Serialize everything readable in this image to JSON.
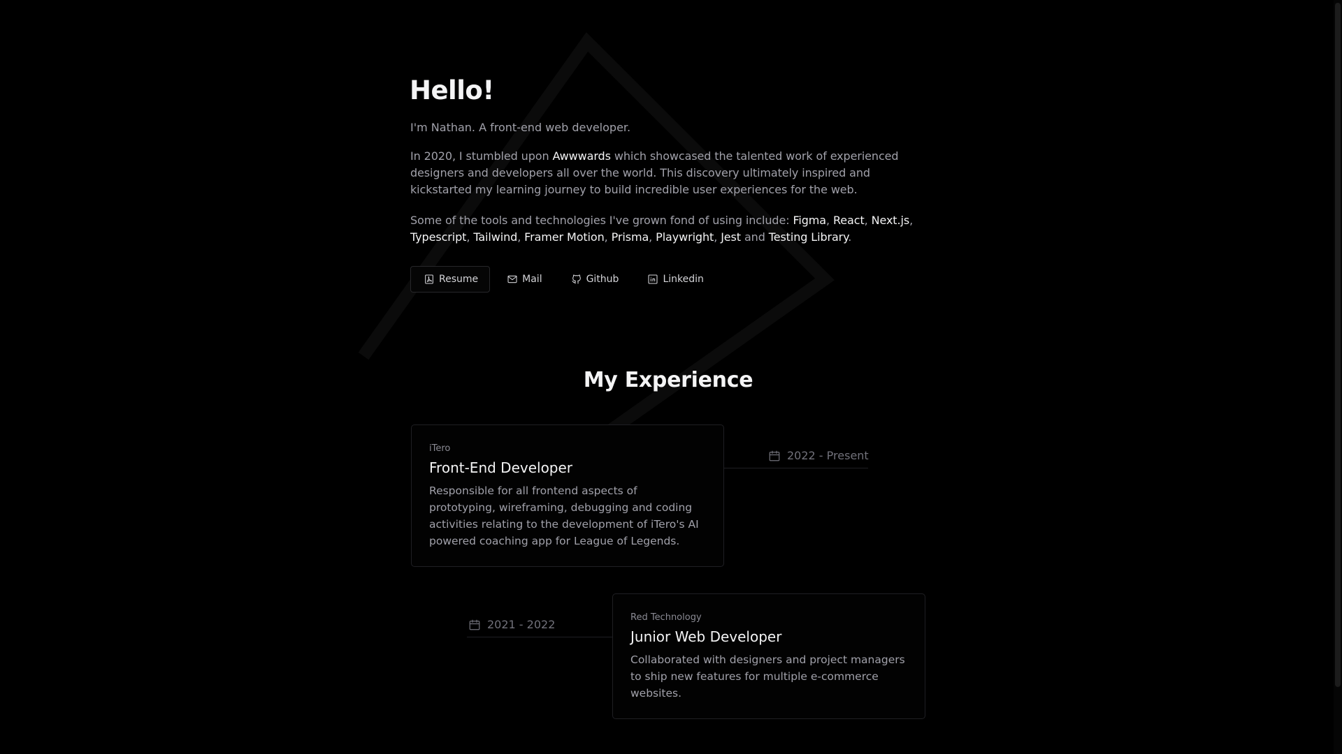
{
  "intro": {
    "heading": "Hello!",
    "tagline": "I'm Nathan. A front-end web developer.",
    "story": {
      "part1": "In 2020, I stumbled upon ",
      "highlight": "Awwwards",
      "part2": " which showcased the talented work of experienced designers and developers all over the world. This discovery ultimately inspired and kickstarted my learning journey to build incredible user experiences for the web."
    },
    "tools": {
      "prefix": "Some of the tools and technologies I've grown fond of using include: ",
      "items": [
        "Figma",
        "React",
        "Next.js",
        "Typescript",
        "Tailwind",
        "Framer Motion",
        "Prisma",
        "Playwright",
        "Jest",
        "Testing Library"
      ],
      "and_word": " and ",
      "suffix": "."
    }
  },
  "links": {
    "resume": "Resume",
    "mail": "Mail",
    "github": "Github",
    "linkedin": "Linkedin"
  },
  "experience": {
    "title": "My Experience",
    "jobs": [
      {
        "company": "iTero",
        "role": "Front-End Developer",
        "description": "Responsible for all frontend aspects of prototyping, wireframing, debugging and coding activities relating to the development of iTero's AI powered coaching app for League of Legends.",
        "dates": "2022 - Present"
      },
      {
        "company": "Red Technology",
        "role": "Junior Web Developer",
        "description": "Collaborated with designers and project managers to ship new features for multiple e-commerce websites.",
        "dates": "2021 - 2022"
      }
    ]
  },
  "icons": {
    "resume": "pdf-file-icon",
    "mail": "mail-icon",
    "github": "github-icon",
    "linkedin": "linkedin-icon",
    "date": "calendar-icon"
  },
  "colors": {
    "background": "#000000",
    "heading": "#f4f4f5",
    "body": "#a1a1aa",
    "muted": "#71717a",
    "border": "#1f1f23"
  }
}
